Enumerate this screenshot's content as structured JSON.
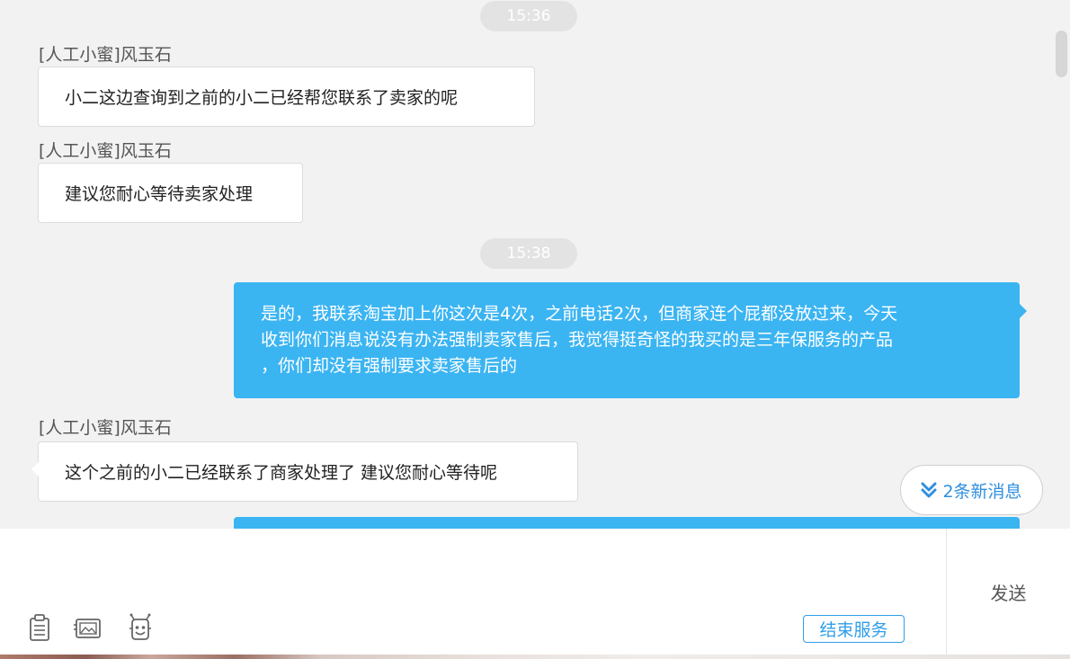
{
  "chat": {
    "times": [
      "15:36",
      "15:38"
    ],
    "messages": [
      {
        "sender": "[人工小蜜]风玉石",
        "text": "小二这边查询到之前的小二已经帮您联系了卖家的呢"
      },
      {
        "sender": "[人工小蜜]风玉石",
        "text": "建议您耐心等待卖家处理"
      },
      {
        "lines": [
          "是的，我联系淘宝加上你这次是4次，之前电话2次，但商家连个屁都没放过来，今天",
          "收到你们消息说没有办法强制卖家售后，我觉得挺奇怪的我买的是三年保服务的产品",
          "，你们却没有强制要求卖家售后的"
        ]
      },
      {
        "sender": "[人工小蜜]风玉石",
        "text": "这个之前的小二已经联系了商家处理了 建议您耐心等待呢"
      }
    ],
    "new_messages_label": "2条新消息"
  },
  "input": {
    "send_label": "发送",
    "end_service_label": "结束服务",
    "tools": [
      "clipboard-icon",
      "image-icon",
      "robot-icon"
    ]
  },
  "colors": {
    "accent": "#3bb4f2",
    "link": "#2f9ee8"
  }
}
